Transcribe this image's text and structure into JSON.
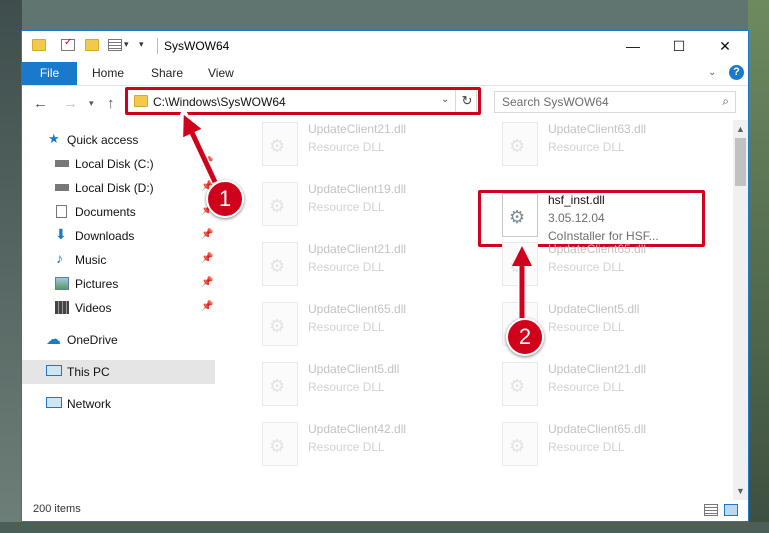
{
  "window": {
    "title": "SysWOW64",
    "controls": {
      "minimize": "—",
      "maximize": "☐",
      "close": "✕"
    }
  },
  "ribbon": {
    "tabs": [
      "File",
      "Home",
      "Share",
      "View"
    ],
    "help": "?"
  },
  "address": {
    "path": "C:\\Windows\\SysWOW64",
    "search_placeholder": "Search SysWOW64"
  },
  "sidebar": {
    "items": [
      {
        "label": "Quick access",
        "icon": "star-icon"
      },
      {
        "label": "Local Disk (C:)",
        "icon": "drive-icon"
      },
      {
        "label": "Local Disk (D:)",
        "icon": "drive-icon"
      },
      {
        "label": "Documents",
        "icon": "documents-icon"
      },
      {
        "label": "Downloads",
        "icon": "download-icon"
      },
      {
        "label": "Music",
        "icon": "music-icon"
      },
      {
        "label": "Pictures",
        "icon": "pictures-icon"
      },
      {
        "label": "Videos",
        "icon": "videos-icon"
      },
      {
        "label": "OneDrive",
        "icon": "cloud-icon"
      },
      {
        "label": "This PC",
        "icon": "computer-icon"
      },
      {
        "label": "Network",
        "icon": "network-icon"
      }
    ]
  },
  "files": [
    {
      "name": "UpdateClient21.dll",
      "type": "Resource DLL"
    },
    {
      "name": "UpdateClient63.dll",
      "type": "Resource DLL"
    },
    {
      "name": "UpdateClient19.dll",
      "type": "Resource DLL"
    },
    {
      "name": "hsf_inst.dll",
      "version": "3.05.12.04",
      "type": "CoInstaller for HSF..."
    },
    {
      "name": "UpdateClient21.dll",
      "type": "Resource DLL"
    },
    {
      "name": "UpdateClient65.dll",
      "type": "Resource DLL"
    },
    {
      "name": "UpdateClient65.dll",
      "type": "Resource DLL"
    },
    {
      "name": "UpdateClient5.dll",
      "type": "Resource DLL"
    },
    {
      "name": "UpdateClient5.dll",
      "type": "Resource DLL"
    },
    {
      "name": "UpdateClient21.dll",
      "type": "Resource DLL"
    },
    {
      "name": "UpdateClient42.dll",
      "type": "Resource DLL"
    },
    {
      "name": "UpdateClient65.dll",
      "type": "Resource DLL"
    }
  ],
  "status": {
    "item_count": "200 items"
  },
  "annotations": {
    "step1": "1",
    "step2": "2"
  },
  "colors": {
    "accent": "#1979ca",
    "highlight": "#d0021b",
    "selected_nav": "#e5e5e5"
  }
}
